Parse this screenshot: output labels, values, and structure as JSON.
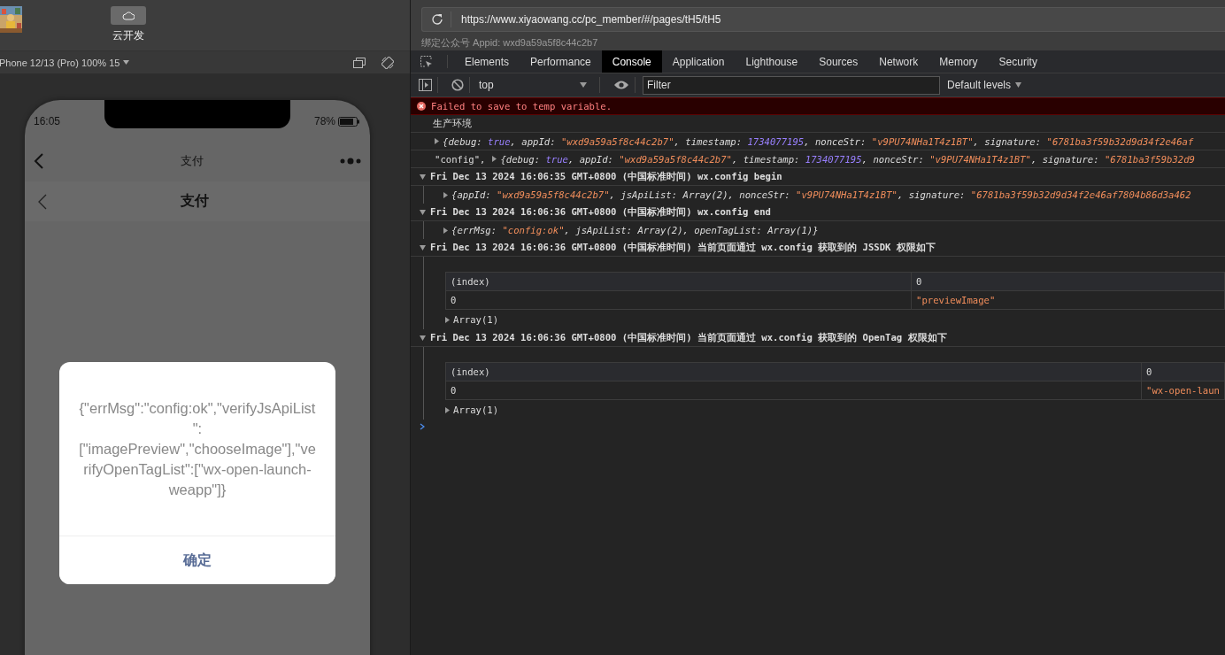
{
  "simulator_toolbar": {
    "cloud_button": {
      "label": "云开发"
    }
  },
  "device_bar": {
    "device": "Phone 12/13 (Pro) 100% 15"
  },
  "phone": {
    "status_time": "16:05",
    "battery": "78%",
    "nav_title": "支付",
    "page_title": "支付",
    "dialog": {
      "message": "{\"errMsg\":\"config:ok\",\"verifyJsApiList\":[\"imagePreview\",\"chooseImage\"],\"verifyOpenTagList\":[\"wx-open-launch-weapp\"]}",
      "button": "确定"
    }
  },
  "address_bar": {
    "url": "https://www.xiyaowang.cc/pc_member/#/pages/tH5/tH5"
  },
  "appid_note": "绑定公众号 Appid: wxd9a59a5f8c44c2b7",
  "devtools": {
    "tabs": [
      {
        "label": "Elements",
        "selected": false
      },
      {
        "label": "Performance",
        "selected": false
      },
      {
        "label": "Console",
        "selected": true
      },
      {
        "label": "Application",
        "selected": false
      },
      {
        "label": "Lighthouse",
        "selected": false
      },
      {
        "label": "Sources",
        "selected": false
      },
      {
        "label": "Network",
        "selected": false
      },
      {
        "label": "Memory",
        "selected": false
      },
      {
        "label": "Security",
        "selected": false
      }
    ],
    "context": "top",
    "filter": {
      "placeholder": "Filter"
    },
    "levels": "Default levels",
    "messages": [
      {
        "kind": "error",
        "text": "Failed to save to temp variable."
      },
      {
        "kind": "log",
        "text": "生产环境"
      },
      {
        "kind": "object",
        "expanded": false,
        "tokens": [
          {
            "kind": "plain",
            "text": "{debug: "
          },
          {
            "kind": "literal",
            "text": "true"
          },
          {
            "kind": "plain",
            "text": ", appId: "
          },
          {
            "kind": "string",
            "text": "\"wxd9a59a5f8c44c2b7\""
          },
          {
            "kind": "plain",
            "text": ", timestamp: "
          },
          {
            "kind": "literal",
            "text": "1734077195"
          },
          {
            "kind": "plain",
            "text": ", nonceStr: "
          },
          {
            "kind": "string",
            "text": "\"v9PU74NHa1T4z1BT\""
          },
          {
            "kind": "plain",
            "text": ", signature: "
          },
          {
            "kind": "string",
            "text": "\"6781ba3f59b32d9d34f2e46af"
          }
        ]
      },
      {
        "kind": "object",
        "prefix": "\"config\",",
        "expanded": false,
        "tokens": [
          {
            "kind": "plain",
            "text": "{debug: "
          },
          {
            "kind": "literal",
            "text": "true"
          },
          {
            "kind": "plain",
            "text": ", appId: "
          },
          {
            "kind": "string",
            "text": "\"wxd9a59a5f8c44c2b7\""
          },
          {
            "kind": "plain",
            "text": ", timestamp: "
          },
          {
            "kind": "literal",
            "text": "1734077195"
          },
          {
            "kind": "plain",
            "text": ", nonceStr: "
          },
          {
            "kind": "string",
            "text": "\"v9PU74NHa1T4z1BT\""
          },
          {
            "kind": "plain",
            "text": ", signature: "
          },
          {
            "kind": "string",
            "text": "\"6781ba3f59b32d9"
          }
        ]
      },
      {
        "kind": "group",
        "expanded": true,
        "title": "Fri Dec 13 2024 16:06:35 GMT+0800 (中国标准时间) wx.config begin",
        "children": [
          {
            "kind": "object",
            "expanded": false,
            "tokens": [
              {
                "kind": "plain",
                "text": "{appId: "
              },
              {
                "kind": "string",
                "text": "\"wxd9a59a5f8c44c2b7\""
              },
              {
                "kind": "plain",
                "text": ", jsApiList: Array(2), nonceStr: "
              },
              {
                "kind": "string",
                "text": "\"v9PU74NHa1T4z1BT\""
              },
              {
                "kind": "plain",
                "text": ", signature: "
              },
              {
                "kind": "string",
                "text": "\"6781ba3f59b32d9d34f2e46af7804b86d3a462"
              }
            ]
          }
        ]
      },
      {
        "kind": "group",
        "expanded": true,
        "title": "Fri Dec 13 2024 16:06:36 GMT+0800 (中国标准时间) wx.config end",
        "children": [
          {
            "kind": "object",
            "expanded": false,
            "tokens": [
              {
                "kind": "plain",
                "text": "{errMsg: "
              },
              {
                "kind": "string",
                "text": "\"config:ok\""
              },
              {
                "kind": "plain",
                "text": ", jsApiList: Array(2), openTagList: Array(1)}"
              }
            ]
          }
        ]
      },
      {
        "kind": "group",
        "expanded": true,
        "title": "Fri Dec 13 2024 16:06:36 GMT+0800 (中国标准时间) 当前页面通过 wx.config 获取到的 JSSDK 权限如下",
        "children": [
          {
            "kind": "table",
            "columns": [
              "(index)",
              "0"
            ],
            "rows": [
              [
                "0",
                "\"previewImage\""
              ]
            ]
          },
          {
            "kind": "array",
            "expanded": false,
            "text": "Array(1)"
          }
        ]
      },
      {
        "kind": "group",
        "expanded": true,
        "title": "Fri Dec 13 2024 16:06:36 GMT+0800 (中国标准时间) 当前页面通过 wx.config 获取到的 OpenTag 权限如下",
        "children": [
          {
            "kind": "table",
            "columns": [
              "(index)",
              "0"
            ],
            "rows": [
              [
                "0",
                "\"wx-open-laun"
              ]
            ]
          },
          {
            "kind": "array",
            "expanded": false,
            "text": "Array(1)"
          }
        ]
      },
      {
        "kind": "prompt"
      }
    ]
  }
}
